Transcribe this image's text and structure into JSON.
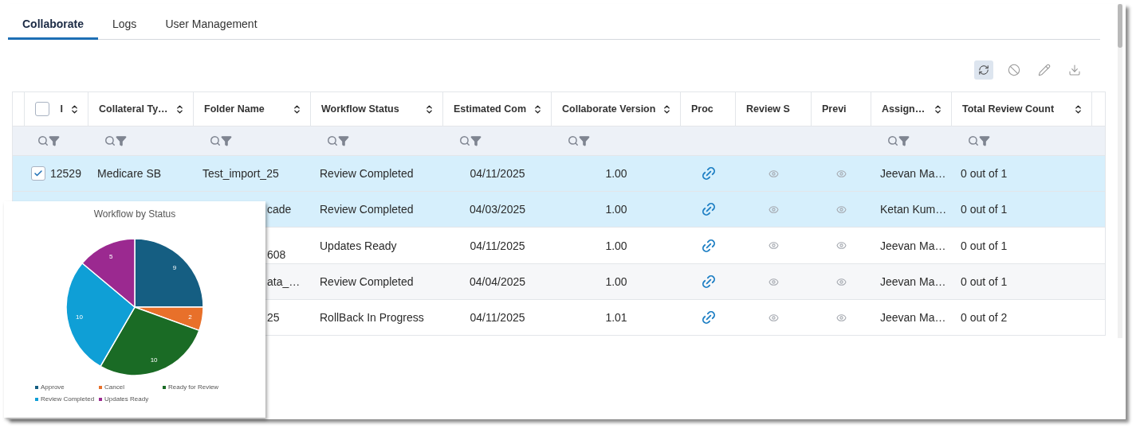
{
  "tabs": [
    {
      "label": "Collaborate",
      "selected": true
    },
    {
      "label": "Logs",
      "selected": false
    },
    {
      "label": "User Management",
      "selected": false
    }
  ],
  "toolbar": [
    {
      "kind": "refresh",
      "active": true
    },
    {
      "kind": "cancel",
      "active": false
    },
    {
      "kind": "edit",
      "active": false
    },
    {
      "kind": "download",
      "active": false
    }
  ],
  "table": {
    "select_all": {
      "checked": false
    },
    "columns": [
      {
        "label": "I",
        "sortable": true,
        "filterable": true
      },
      {
        "label": "Collateral Ty…",
        "sortable": true,
        "filterable": true
      },
      {
        "label": "Folder Name",
        "sortable": true,
        "filterable": true
      },
      {
        "label": "Workflow Status",
        "sortable": true,
        "filterable": true
      },
      {
        "label": "Estimated Com",
        "sortable": true,
        "filterable": true
      },
      {
        "label": "Collaborate Version",
        "sortable": true,
        "filterable": true
      },
      {
        "label": "Proc",
        "sortable": false,
        "filterable": false
      },
      {
        "label": "Review S",
        "sortable": false,
        "filterable": false
      },
      {
        "label": "Previ",
        "sortable": false,
        "filterable": false
      },
      {
        "label": "Assign…",
        "sortable": true,
        "filterable": true
      },
      {
        "label": "Total Review Count",
        "sortable": true,
        "filterable": true
      }
    ],
    "rows": [
      {
        "selected": true,
        "checked": true,
        "cells": [
          {
            "kind": "text",
            "text": "12529"
          },
          {
            "kind": "text",
            "text": "Medicare SB"
          },
          {
            "kind": "text",
            "text": "Test_import_25"
          },
          {
            "kind": "text",
            "text": "Review Completed"
          },
          {
            "kind": "text",
            "text": "04/11/2025"
          },
          {
            "kind": "text",
            "text": "1.00"
          },
          {
            "kind": "link"
          },
          {
            "kind": "view"
          },
          {
            "kind": "view"
          },
          {
            "kind": "text",
            "text": "Jeevan Ma…"
          },
          {
            "kind": "text",
            "text": "0 out of 1"
          }
        ]
      },
      {
        "selected": true,
        "cells": [
          {
            "kind": "hidden"
          },
          {
            "kind": "hidden"
          },
          {
            "kind": "partial",
            "text": "cade"
          },
          {
            "kind": "text",
            "text": "Review Completed"
          },
          {
            "kind": "text",
            "text": "04/03/2025"
          },
          {
            "kind": "text",
            "text": "1.00"
          },
          {
            "kind": "link"
          },
          {
            "kind": "view"
          },
          {
            "kind": "view"
          },
          {
            "kind": "text",
            "text": "Ketan Kum…"
          },
          {
            "kind": "text",
            "text": "0 out of 1"
          }
        ]
      },
      {
        "selected": false,
        "cells": [
          {
            "kind": "hidden"
          },
          {
            "kind": "hidden"
          },
          {
            "kind": "partial-low",
            "text": "608"
          },
          {
            "kind": "text",
            "text": "Updates Ready"
          },
          {
            "kind": "text",
            "text": "04/11/2025"
          },
          {
            "kind": "text",
            "text": "1.00"
          },
          {
            "kind": "link"
          },
          {
            "kind": "view"
          },
          {
            "kind": "view"
          },
          {
            "kind": "text",
            "text": "Jeevan Ma…"
          },
          {
            "kind": "text",
            "text": "0 out of 1"
          }
        ]
      },
      {
        "selected": false,
        "cells": [
          {
            "kind": "hidden"
          },
          {
            "kind": "hidden"
          },
          {
            "kind": "partial",
            "text": "ata_…"
          },
          {
            "kind": "text",
            "text": "Review Completed"
          },
          {
            "kind": "text",
            "text": "04/04/2025"
          },
          {
            "kind": "text",
            "text": "1.00"
          },
          {
            "kind": "link"
          },
          {
            "kind": "view"
          },
          {
            "kind": "view"
          },
          {
            "kind": "text",
            "text": "Jeevan Ma…"
          },
          {
            "kind": "text",
            "text": "0 out of 1"
          }
        ]
      },
      {
        "selected": false,
        "cells": [
          {
            "kind": "hidden"
          },
          {
            "kind": "hidden"
          },
          {
            "kind": "partial",
            "text": "25"
          },
          {
            "kind": "text",
            "text": "RollBack In Progress"
          },
          {
            "kind": "text",
            "text": "04/11/2025"
          },
          {
            "kind": "text",
            "text": "1.01"
          },
          {
            "kind": "link"
          },
          {
            "kind": "view"
          },
          {
            "kind": "view"
          },
          {
            "kind": "text",
            "text": "Jeevan Ma…"
          },
          {
            "kind": "text",
            "text": "0 out of 2"
          }
        ]
      }
    ]
  },
  "chart_panel": {
    "chart_data": {
      "type": "pie",
      "title": "Workflow by Status",
      "categories": [
        "Approve",
        "Cancel",
        "Ready for Review",
        "Review Completed",
        "Updates Ready"
      ],
      "data_labels": true,
      "values": [
        9,
        2,
        10,
        10,
        5
      ],
      "colors": [
        "#155e82",
        "#e8702a",
        "#1a6b25",
        "#0f9fd6",
        "#9b2990"
      ]
    }
  }
}
